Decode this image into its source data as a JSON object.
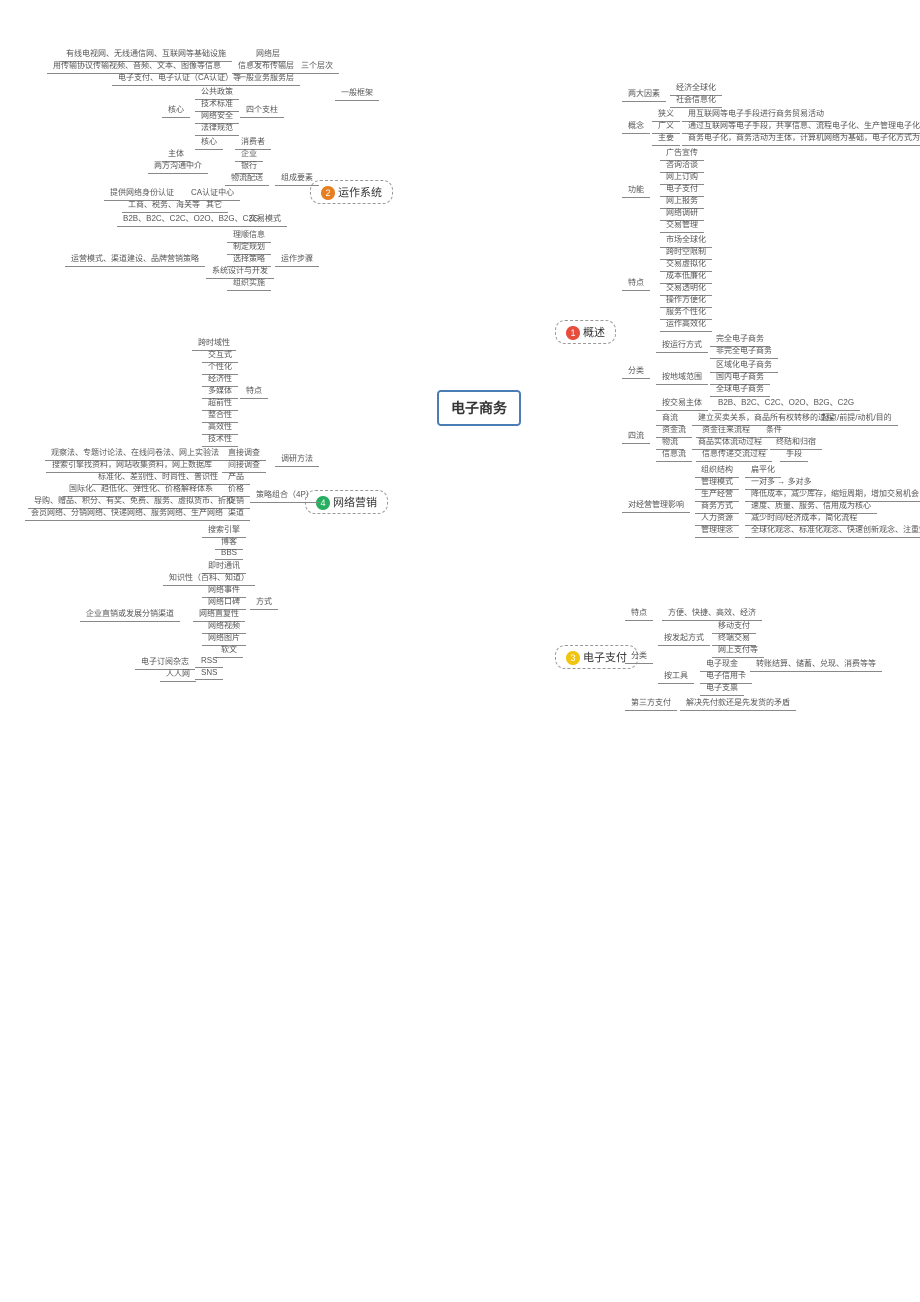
{
  "root": "电子商务",
  "mains": {
    "m1": "概述",
    "m2": "运作系统",
    "m3": "电子支付",
    "m4": "网络营销"
  },
  "r": {
    "r1": "经济全球化",
    "r2": "社会信息化",
    "r3": "两大因素",
    "r4": "狭义",
    "r5": "用互联网等电子手段进行商务贸易活动",
    "r6": "广义",
    "r7": "通过互联网等电子手段，共享信息、流程电子化、生产管理电子化、提高效率",
    "r8": "主要",
    "r9": "商务电子化，商务活动为主体，计算机网络为基础，电子化方式为手段",
    "r10": "概念",
    "r11": "广告宣传",
    "r12": "咨询洽谈",
    "r13": "网上订购",
    "r14": "电子支付",
    "r15": "网上报务",
    "r16": "网络调研",
    "r17": "交易管理",
    "r18": "功能",
    "r19": "市场全球化",
    "r20": "跨时空限制",
    "r21": "交易虚拟化",
    "r22": "成本低廉化",
    "r23": "交易透明化",
    "r24": "操作方便化",
    "r25": "服务个性化",
    "r26": "运作高效化",
    "r27": "特点",
    "r28": "完全电子商务",
    "r29": "非完全电子商务",
    "r30": "按运行方式",
    "r31": "区域化电子商务",
    "r32": "国内电子商务",
    "r33": "全球电子商务",
    "r34": "按地域范围",
    "r35": "按交易主体",
    "r36": "B2B、B2C、C2C、O2O、B2G、C2G",
    "r37": "分类",
    "r38": "商流",
    "r39": "建立买卖关系，商品所有权转移的过程",
    "r40": "起点/前提/动机/目的",
    "r41": "资金流",
    "r42": "资金往来流程",
    "r43": "条件",
    "r44": "物流",
    "r45": "商品实体流动过程",
    "r46": "终结和归宿",
    "r47": "信息流",
    "r48": "信息传递交流过程",
    "r49": "手段",
    "r50": "四流",
    "r51": "组织结构",
    "r52": "扁平化",
    "r53": "管理模式",
    "r54": "一对多 → 多对多",
    "r55": "生产经营",
    "r56": "降低成本，减少库存，缩短周期，增加交易机会",
    "r57": "商务方式",
    "r58": "速度、质量、服务、信用成为核心",
    "r59": "人力资源",
    "r60": "减少时间/经济成本，简化流程",
    "r61": "管理理念",
    "r62": "全球化观念、标准化观念、快速创新观念、注重知识观念",
    "r63": "对经营管理影响",
    "p1": "特点",
    "p2": "方便、快捷、高效、经济",
    "p3": "移动支付",
    "p4": "终端交易",
    "p5": "网上支付等",
    "p6": "按发起方式",
    "p7": "电子现金",
    "p8": "转账结算、储蓄、兑现、消费等等",
    "p9": "电子信用卡",
    "p10": "电子支票",
    "p11": "按工具",
    "p12": "分类",
    "p13": "第三方支付",
    "p14": "解决先付款还是先发货的矛盾"
  },
  "l": {
    "l1": "有线电视网、无线通信网、互联网等基础设施",
    "l2": "网络层",
    "l3": "用传输协议传输视频、音频、文本、图像等信息",
    "l4": "信息发布传输层",
    "l5": "电子支付、电子认证（CA认证）等",
    "l6": "一般业务服务层",
    "l7": "三个层次",
    "l8": "公共政策",
    "l9": "技术标准",
    "l10": "网络安全",
    "l11": "法律规范",
    "l12": "四个支柱",
    "l13": "核心",
    "l14": "一般框架",
    "l15": "主体",
    "l16": "消费者",
    "l17": "企业",
    "l18": "银行",
    "l19": "物流配送",
    "l20": "两方沟通中介",
    "l21": "核心",
    "l22": "提供网络身份认证",
    "l23": "CA认证中心",
    "l24": "工商、税务、海关等",
    "l25": "其它",
    "l26": "B2B、B2C、C2C、O2O、B2G、C2G",
    "l27": "交易模式",
    "l28": "组成要素",
    "l29": "理顺信息",
    "l30": "制定规划",
    "l31": "选择策略",
    "l32": "系统设计与开发",
    "l33": "组织实施",
    "l34": "运作步骤",
    "l35": "运营模式、渠道建设、品牌营销策略",
    "m1": "跨时域性",
    "m2": "交互式",
    "m3": "个性化",
    "m4": "经济性",
    "m5": "多媒体",
    "m6": "超前性",
    "m7": "整合性",
    "m8": "高效性",
    "m9": "技术性",
    "m10": "特点",
    "m11": "观察法、专题讨论法、在线问卷法、网上实验法",
    "m12": "直接调查",
    "m13": "搜索引擎找资料，网站收集资料，网上数据库",
    "m14": "间接调查",
    "m15": "调研方法",
    "m16": "标准化、差别性、时尚性、普识性",
    "m17": "产品",
    "m18": "国际化、趋低化、弹性化、价格解释体系",
    "m19": "价格",
    "m20": "导购、赠品、积分、有奖、免费、服务、虚拟货币、折扣",
    "m21": "促销",
    "m22": "会员网络、分销网络、快递网络、服务网络、生产网络",
    "m23": "渠道",
    "m24": "策略组合（4P）",
    "m25": "搜索引擎",
    "m26": "博客",
    "m27": "BBS",
    "m28": "即时通讯",
    "m29": "知识性（百科、知道）",
    "m30": "网络事件",
    "m31": "网络口碑",
    "m32": "方式",
    "m33": "企业直销或发展分销渠道",
    "m34": "网络直复性",
    "m35": "网络视频",
    "m36": "网络图片",
    "m37": "软文",
    "m38": "RSS",
    "m39": "SNS",
    "m40": "电子订阅杂志",
    "m41": "人人网"
  }
}
